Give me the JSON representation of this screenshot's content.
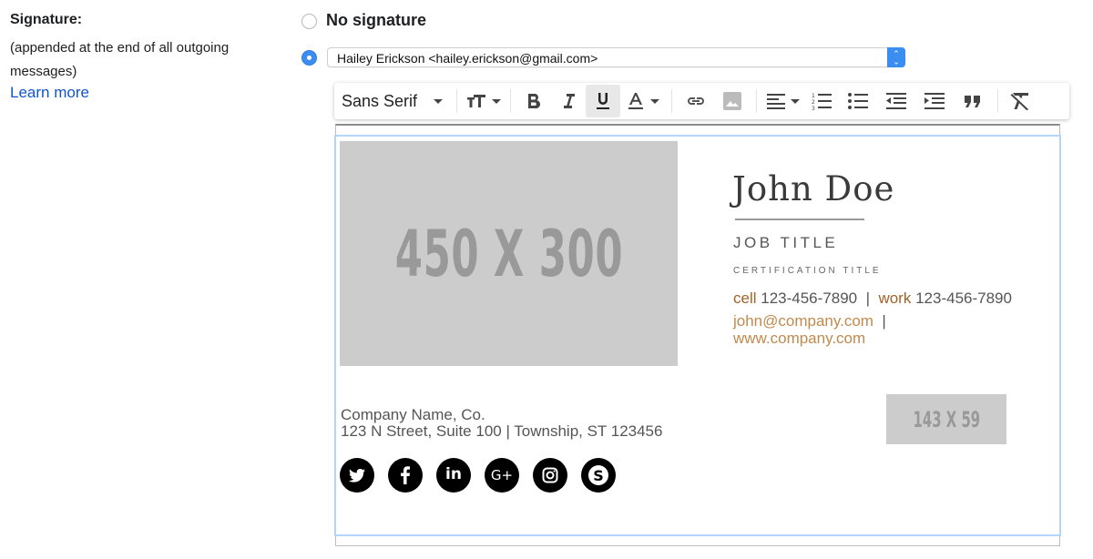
{
  "signature_section": {
    "title": "Signature:",
    "description": "(appended at the end of all outgoing messages)",
    "learn_more": "Learn more"
  },
  "options": {
    "no_signature_label": "No signature",
    "no_signature_selected": false,
    "account_selected": true,
    "account_select_value": "Hailey Erickson <hailey.erickson@gmail.com>"
  },
  "toolbar": {
    "font_family": "Sans Serif",
    "buttons": [
      "font-size",
      "bold",
      "italic",
      "underline",
      "text-color",
      "link",
      "image",
      "align",
      "numbered-list",
      "bulleted-list",
      "indent-less",
      "indent-more",
      "quote",
      "remove-formatting"
    ],
    "active": "underline"
  },
  "signature": {
    "image_placeholder": "450 X 300",
    "name": "John Doe",
    "job_title": "JOB TITLE",
    "certification": "CERTIFICATION TITLE",
    "cell_label": "cell",
    "cell_number": "123-456-7890",
    "work_label": "work",
    "work_number": "123-456-7890",
    "separator": "|",
    "email": "john@company.com",
    "website": "www.company.com",
    "company": "Company Name, Co.",
    "address": "123 N Street, Suite 100 | Township, ST 123456",
    "logo_placeholder": "143 X 59",
    "social": [
      "twitter",
      "facebook",
      "linkedin",
      "google-plus",
      "instagram",
      "skype"
    ],
    "colors": {
      "accent": "#a0632a",
      "link": "#c08a4e",
      "text": "#555555",
      "placeholder_bg": "#cccccc"
    }
  }
}
